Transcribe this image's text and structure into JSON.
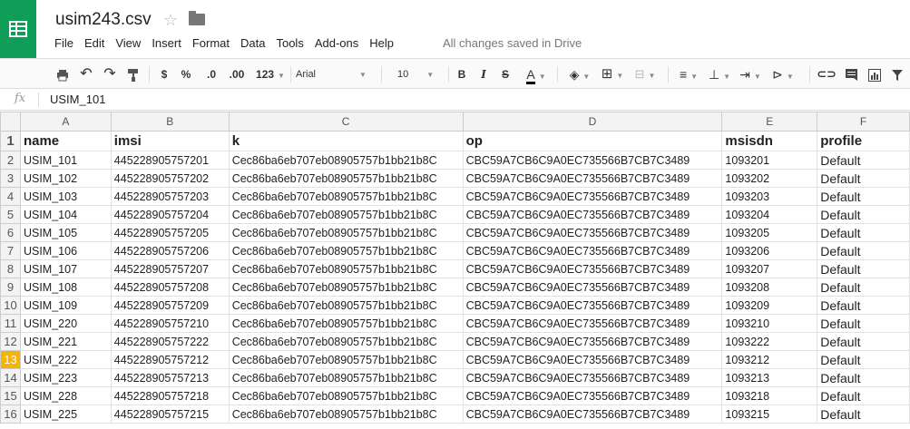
{
  "app": {
    "doc_title": "usim243.csv",
    "menu": [
      "File",
      "Edit",
      "View",
      "Insert",
      "Format",
      "Data",
      "Tools",
      "Add-ons",
      "Help"
    ],
    "save_status": "All changes saved in Drive"
  },
  "toolbar": {
    "currency": "$",
    "percent": "%",
    "dec_less": ".0",
    "dec_more": ".00",
    "format_more": "123",
    "font": "Arial",
    "font_size": "10",
    "bold": "B",
    "italic": "I",
    "strike": "S",
    "text_color": "A"
  },
  "formula_bar": {
    "fx": "fx",
    "value": "USIM_101"
  },
  "columns": [
    "A",
    "B",
    "C",
    "D",
    "E",
    "F"
  ],
  "header_row": {
    "row_number": "1",
    "cells": [
      "name",
      "imsi",
      "k",
      "op",
      "msisdn",
      "profile"
    ]
  },
  "rows": [
    {
      "n": "2",
      "cells": [
        "USIM_101",
        "445228905757201",
        "Cec86ba6eb707eb08905757b1bb21b8C",
        "CBC59A7CB6C9A0EC735566B7CB7C3489",
        "1093201",
        "Default"
      ]
    },
    {
      "n": "3",
      "cells": [
        "USIM_102",
        "445228905757202",
        "Cec86ba6eb707eb08905757b1bb21b8C",
        "CBC59A7CB6C9A0EC735566B7CB7C3489",
        "1093202",
        "Default"
      ]
    },
    {
      "n": "4",
      "cells": [
        "USIM_103",
        "445228905757203",
        "Cec86ba6eb707eb08905757b1bb21b8C",
        "CBC59A7CB6C9A0EC735566B7CB7C3489",
        "1093203",
        "Default"
      ]
    },
    {
      "n": "5",
      "cells": [
        "USIM_104",
        "445228905757204",
        "Cec86ba6eb707eb08905757b1bb21b8C",
        "CBC59A7CB6C9A0EC735566B7CB7C3489",
        "1093204",
        "Default"
      ]
    },
    {
      "n": "6",
      "cells": [
        "USIM_105",
        "445228905757205",
        "Cec86ba6eb707eb08905757b1bb21b8C",
        "CBC59A7CB6C9A0EC735566B7CB7C3489",
        "1093205",
        "Default"
      ]
    },
    {
      "n": "7",
      "cells": [
        "USIM_106",
        "445228905757206",
        "Cec86ba6eb707eb08905757b1bb21b8C",
        "CBC59A7CB6C9A0EC735566B7CB7C3489",
        "1093206",
        "Default"
      ]
    },
    {
      "n": "8",
      "cells": [
        "USIM_107",
        "445228905757207",
        "Cec86ba6eb707eb08905757b1bb21b8C",
        "CBC59A7CB6C9A0EC735566B7CB7C3489",
        "1093207",
        "Default"
      ]
    },
    {
      "n": "9",
      "cells": [
        "USIM_108",
        "445228905757208",
        "Cec86ba6eb707eb08905757b1bb21b8C",
        "CBC59A7CB6C9A0EC735566B7CB7C3489",
        "1093208",
        "Default"
      ]
    },
    {
      "n": "10",
      "cells": [
        "USIM_109",
        "445228905757209",
        "Cec86ba6eb707eb08905757b1bb21b8C",
        "CBC59A7CB6C9A0EC735566B7CB7C3489",
        "1093209",
        "Default"
      ]
    },
    {
      "n": "11",
      "cells": [
        "USIM_220",
        "445228905757210",
        "Cec86ba6eb707eb08905757b1bb21b8C",
        "CBC59A7CB6C9A0EC735566B7CB7C3489",
        "1093210",
        "Default"
      ]
    },
    {
      "n": "12",
      "cells": [
        "USIM_221",
        "445228905757222",
        "Cec86ba6eb707eb08905757b1bb21b8C",
        "CBC59A7CB6C9A0EC735566B7CB7C3489",
        "1093222",
        "Default"
      ]
    },
    {
      "n": "13",
      "cells": [
        "USIM_222",
        "445228905757212",
        "Cec86ba6eb707eb08905757b1bb21b8C",
        "CBC59A7CB6C9A0EC735566B7CB7C3489",
        "1093212",
        "Default"
      ],
      "selected": true
    },
    {
      "n": "14",
      "cells": [
        "USIM_223",
        "445228905757213",
        "Cec86ba6eb707eb08905757b1bb21b8C",
        "CBC59A7CB6C9A0EC735566B7CB7C3489",
        "1093213",
        "Default"
      ]
    },
    {
      "n": "15",
      "cells": [
        "USIM_228",
        "445228905757218",
        "Cec86ba6eb707eb08905757b1bb21b8C",
        "CBC59A7CB6C9A0EC735566B7CB7C3489",
        "1093218",
        "Default"
      ]
    },
    {
      "n": "16",
      "cells": [
        "USIM_225",
        "445228905757215",
        "Cec86ba6eb707eb08905757b1bb21b8C",
        "CBC59A7CB6C9A0EC735566B7CB7C3489",
        "1093215",
        "Default"
      ]
    }
  ],
  "colors": {
    "brand": "#0f9d58",
    "selected_row_header": "#f4b400"
  }
}
